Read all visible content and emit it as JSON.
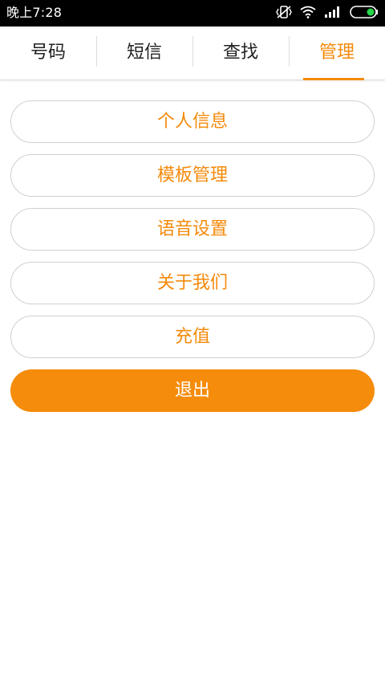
{
  "statusbar": {
    "time": "晚上7:28",
    "icons": [
      "vibrate-off-icon",
      "wifi-icon",
      "signal-icon",
      "battery-icon"
    ]
  },
  "tabs": [
    {
      "label": "号码"
    },
    {
      "label": "短信"
    },
    {
      "label": "查找"
    },
    {
      "label": "管理"
    }
  ],
  "active_tab": "管理",
  "menu": {
    "items": [
      {
        "label": "个人信息"
      },
      {
        "label": "模板管理"
      },
      {
        "label": "语音设置"
      },
      {
        "label": "关于我们"
      },
      {
        "label": "充值"
      }
    ],
    "logout_label": "退出"
  },
  "colors": {
    "accent": "#f58a0b",
    "statusbar_bg": "#000000",
    "battery_fill": "#27d64a"
  }
}
